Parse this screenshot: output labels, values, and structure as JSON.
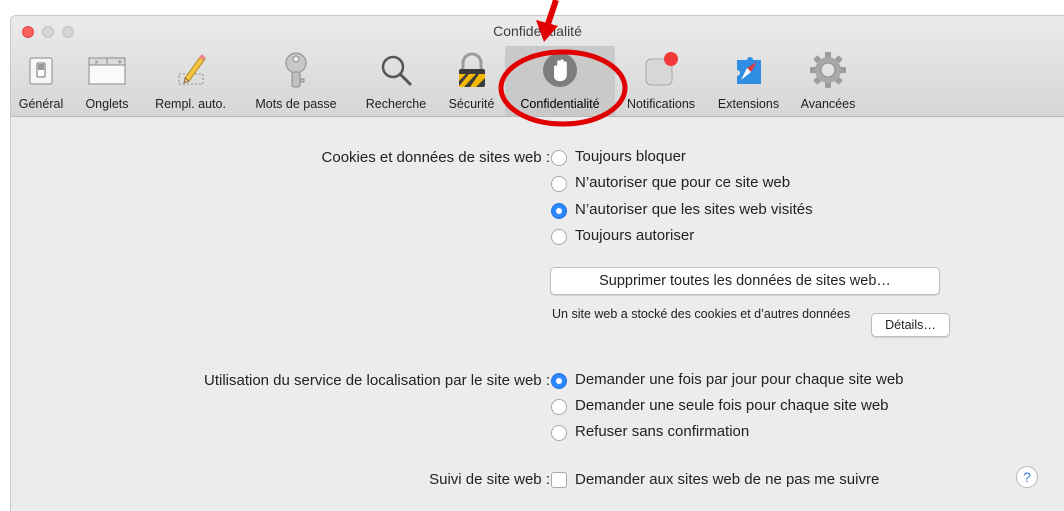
{
  "window": {
    "title": "Confidentialité"
  },
  "tabs": [
    {
      "label": "Général",
      "icon": "general-icon"
    },
    {
      "label": "Onglets",
      "icon": "tabs-icon"
    },
    {
      "label": "Rempl. auto.",
      "icon": "pencil-icon"
    },
    {
      "label": "Mots de passe",
      "icon": "key-icon"
    },
    {
      "label": "Recherche",
      "icon": "search-icon"
    },
    {
      "label": "Sécurité",
      "icon": "lock-icon"
    },
    {
      "label": "Confidentialité",
      "icon": "hand-icon",
      "selected": true
    },
    {
      "label": "Notifications",
      "icon": "notifications-icon"
    },
    {
      "label": "Extensions",
      "icon": "extensions-icon"
    },
    {
      "label": "Avancées",
      "icon": "gear-icon"
    }
  ],
  "cookies": {
    "label": "Cookies et données de sites web :",
    "options": [
      {
        "label": "Toujours bloquer",
        "checked": false
      },
      {
        "label": "N’autoriser que pour ce site web",
        "checked": false
      },
      {
        "label": "N’autoriser que les sites web visités",
        "checked": true
      },
      {
        "label": "Toujours autoriser",
        "checked": false
      }
    ],
    "remove_button": "Supprimer toutes les données de sites web…",
    "stored_info": "Un site web a stocké des cookies et d’autres données",
    "details_button": "Détails…"
  },
  "location": {
    "label": "Utilisation du service de localisation par le site web :",
    "options": [
      {
        "label": "Demander une fois par jour pour chaque site web",
        "checked": true
      },
      {
        "label": "Demander une seule fois pour chaque site web",
        "checked": false
      },
      {
        "label": "Refuser sans confirmation",
        "checked": false
      }
    ]
  },
  "tracking": {
    "label": "Suivi de site web :",
    "checkbox_label": "Demander aux sites web de ne pas me suivre",
    "checked": false
  },
  "help_button": "?",
  "colors": {
    "accent": "#2d88ff",
    "annotation": "#e00000",
    "selected_tab": "#c9c9c9"
  }
}
